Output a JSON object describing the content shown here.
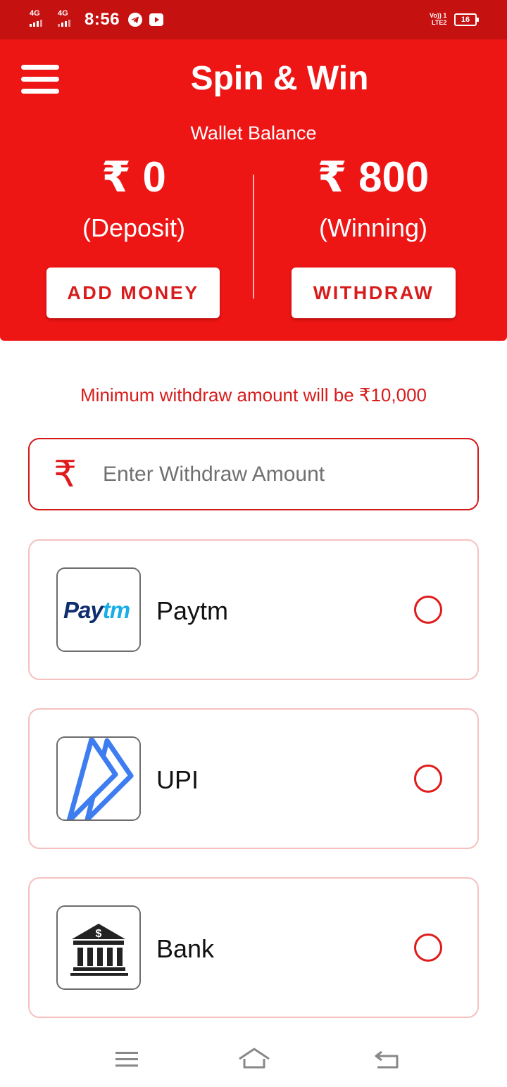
{
  "status_bar": {
    "sim1": "4G",
    "sim2": "4G",
    "time": "8:56",
    "volte_top": "Vo)) 1",
    "volte_bottom": "LTE2",
    "battery": "16"
  },
  "app_bar": {
    "title": "Spin & Win"
  },
  "wallet": {
    "label": "Wallet Balance",
    "deposit_amount": "₹ 0",
    "deposit_label": "(Deposit)",
    "winning_amount": "₹ 800",
    "winning_label": "(Winning)",
    "add_money_label": "ADD MONEY",
    "withdraw_label": "WITHDRAW"
  },
  "notice": "Minimum withdraw amount will be ₹10,000",
  "amount_input": {
    "placeholder": "Enter Withdraw Amount",
    "value": "",
    "icon": "₹"
  },
  "payment_options": [
    {
      "label": "Paytm",
      "logo_text_left": "Pay",
      "logo_text_right": "tm",
      "selected": false
    },
    {
      "label": "UPI",
      "selected": false
    },
    {
      "label": "Bank",
      "logo_symbol": "$",
      "selected": false
    }
  ],
  "colors": {
    "primary": "#ee1515",
    "status_bar": "#c61111",
    "accent_text": "#d81b1b",
    "option_border": "#f6c0c0"
  }
}
